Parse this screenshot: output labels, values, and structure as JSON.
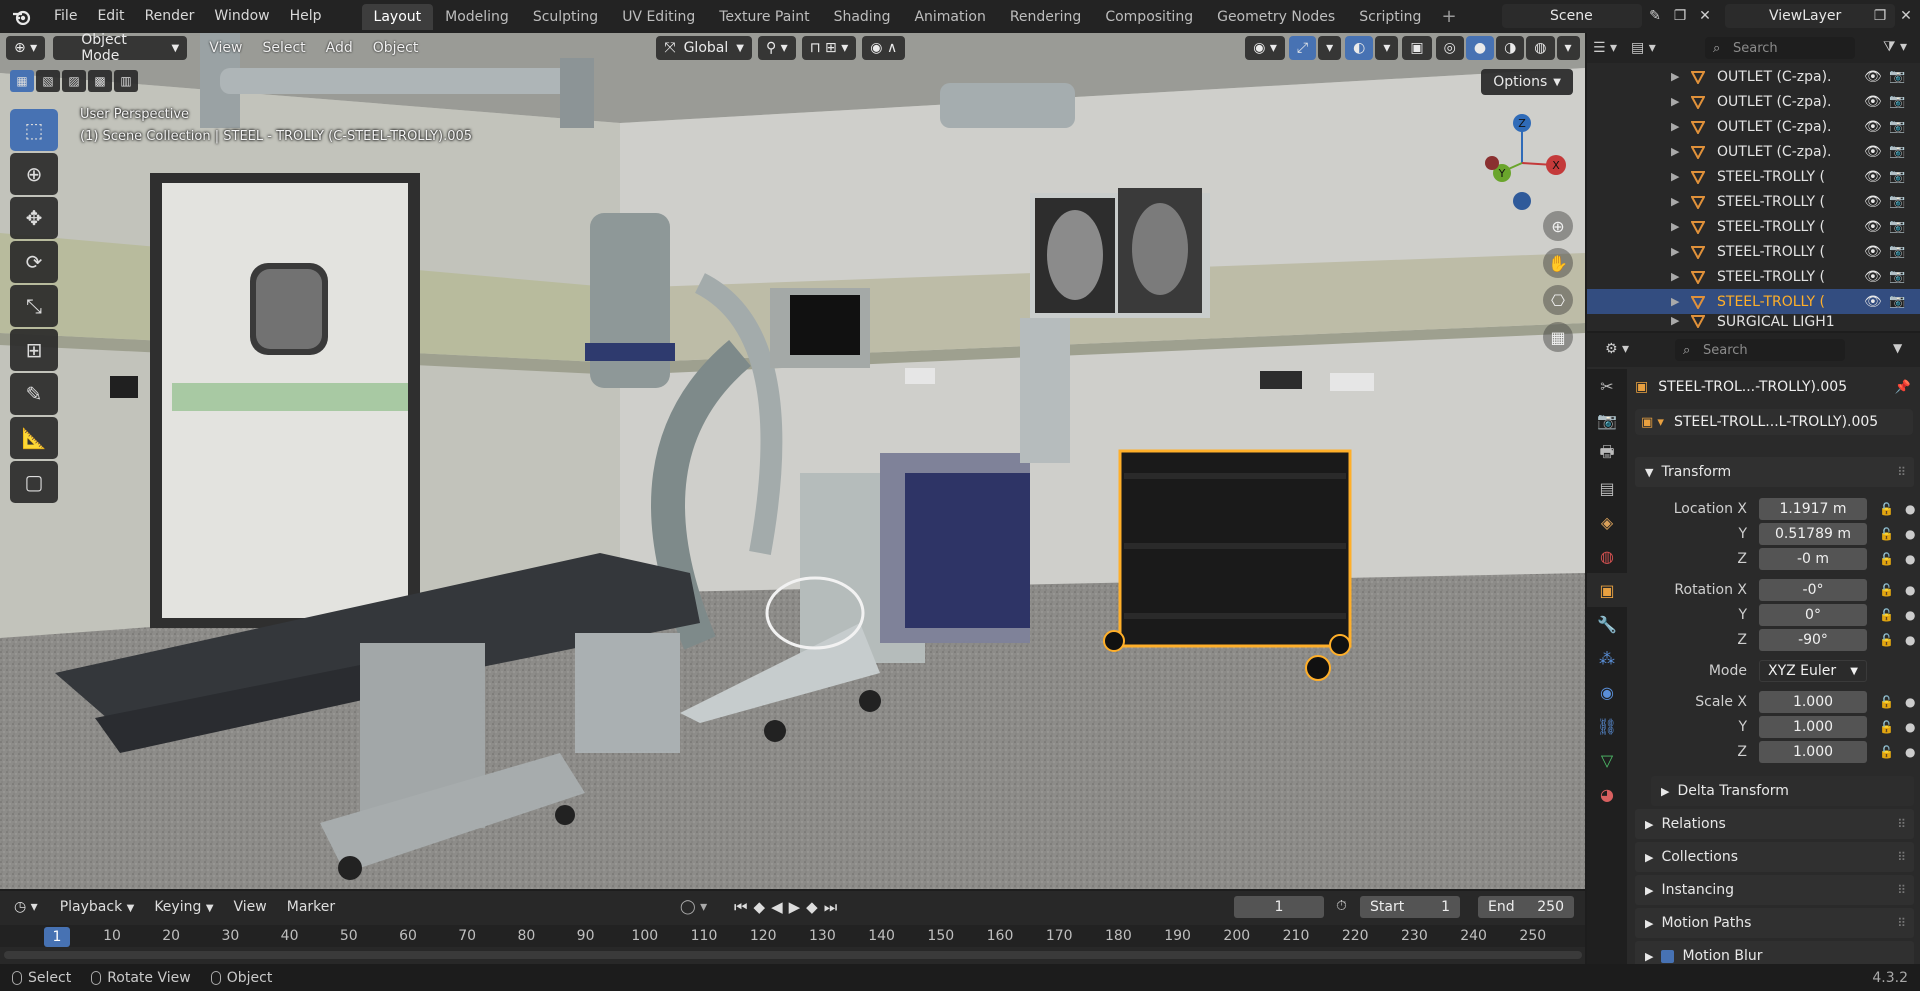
{
  "topbar": {
    "menus": [
      "File",
      "Edit",
      "Render",
      "Window",
      "Help"
    ],
    "workspaces": [
      "Layout",
      "Modeling",
      "Sculpting",
      "UV Editing",
      "Texture Paint",
      "Shading",
      "Animation",
      "Rendering",
      "Compositing",
      "Geometry Nodes",
      "Scripting"
    ],
    "active_workspace": "Layout",
    "scene": "Scene",
    "view_layer": "ViewLayer"
  },
  "viewport": {
    "mode": "Object Mode",
    "menus": [
      "View",
      "Select",
      "Add",
      "Object"
    ],
    "orientation": "Global",
    "options_label": "Options",
    "perspective_label": "User Perspective",
    "collection_label": "(1) Scene Collection | STEEL - TROLLY (C-STEEL-TROLLY).005",
    "gizmo_axes": {
      "x": "X",
      "y": "Y",
      "z": "Z"
    }
  },
  "outliner": {
    "search_placeholder": "Search",
    "rows": [
      {
        "name": "OUTLET (C-zpa).",
        "selected": false
      },
      {
        "name": "OUTLET (C-zpa).",
        "selected": false
      },
      {
        "name": "OUTLET (C-zpa).",
        "selected": false
      },
      {
        "name": "OUTLET (C-zpa).",
        "selected": false
      },
      {
        "name": "STEEL-TROLLY (",
        "selected": false
      },
      {
        "name": "STEEL-TROLLY (",
        "selected": false
      },
      {
        "name": "STEEL-TROLLY (",
        "selected": false
      },
      {
        "name": "STEEL-TROLLY (",
        "selected": false
      },
      {
        "name": "STEEL-TROLLY (",
        "selected": false
      },
      {
        "name": "STEEL-TROLLY (",
        "selected": true
      },
      {
        "name": "SURGICAL LIGH1",
        "selected": false
      }
    ]
  },
  "properties": {
    "search_placeholder": "Search",
    "object_name": "STEEL-TROL...-TROLLY).005",
    "data_name": "STEEL-TROLL...L-TROLLY).005",
    "transform_label": "Transform",
    "location": {
      "label": "Location X",
      "x": "1.1917 m",
      "y": "0.51789 m",
      "z": "-0 m"
    },
    "rotation": {
      "label": "Rotation X",
      "x": "-0°",
      "y": "0°",
      "z": "-90°"
    },
    "mode_label": "Mode",
    "mode_value": "XYZ Euler",
    "scale": {
      "label": "Scale X",
      "x": "1.000",
      "y": "1.000",
      "z": "1.000"
    },
    "axis_y": "Y",
    "axis_z": "Z",
    "delta_transform": "Delta Transform",
    "panels": [
      "Relations",
      "Collections",
      "Instancing",
      "Motion Paths",
      "Motion Blur"
    ]
  },
  "timeline": {
    "menus": [
      "Playback",
      "Keying",
      "View",
      "Marker"
    ],
    "current_frame": "1",
    "start_label": "Start",
    "start_value": "1",
    "end_label": "End",
    "end_value": "250",
    "ruler_marks": [
      "1",
      "10",
      "20",
      "30",
      "40",
      "50",
      "60",
      "70",
      "80",
      "90",
      "100",
      "110",
      "120",
      "130",
      "140",
      "150",
      "160",
      "170",
      "180",
      "190",
      "200",
      "210",
      "220",
      "230",
      "240",
      "250"
    ]
  },
  "statusbar": {
    "items": [
      "Select",
      "Rotate View",
      "Object"
    ],
    "version": "4.3.2"
  },
  "colors": {
    "accent_blue": "#4772b3",
    "selection_orange": "#ffaf29",
    "selected_row": "#334d80"
  }
}
